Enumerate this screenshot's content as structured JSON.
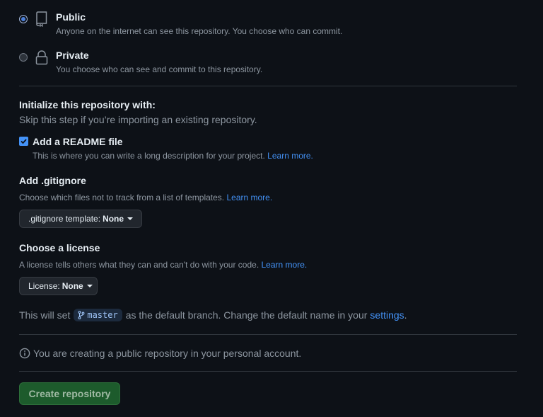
{
  "visibility": {
    "public": {
      "title": "Public",
      "description": "Anyone on the internet can see this repository. You choose who can commit.",
      "selected": true,
      "icon": "repo-icon"
    },
    "private": {
      "title": "Private",
      "description": "You choose who can see and commit to this repository.",
      "selected": false,
      "icon": "lock-icon"
    }
  },
  "initialize": {
    "heading": "Initialize this repository with:",
    "subtext": "Skip this step if you’re importing an existing repository.",
    "readme": {
      "label": "Add a README file",
      "checked": true,
      "description": "This is where you can write a long description for your project.",
      "link": "Learn more."
    }
  },
  "gitignore": {
    "heading": "Add .gitignore",
    "description": "Choose which files not to track from a list of templates.",
    "link": "Learn more.",
    "dropdown_label": ".gitignore template:",
    "dropdown_value": "None"
  },
  "license": {
    "heading": "Choose a license",
    "description": "A license tells others what they can and can't do with your code.",
    "link": "Learn more.",
    "dropdown_label": "License:",
    "dropdown_value": "None"
  },
  "branch": {
    "prefix": "This will set",
    "name": "master",
    "middle": "as the default branch. Change the default name in your",
    "link": "settings",
    "suffix": "."
  },
  "info": {
    "text": "You are creating a public repository in your personal account.",
    "icon": "info-icon"
  },
  "actions": {
    "create_label": "Create repository"
  },
  "colors": {
    "background": "#0d1117",
    "link": "#4493f8",
    "create_button": "#1d5b2c",
    "divider": "#30363d"
  }
}
